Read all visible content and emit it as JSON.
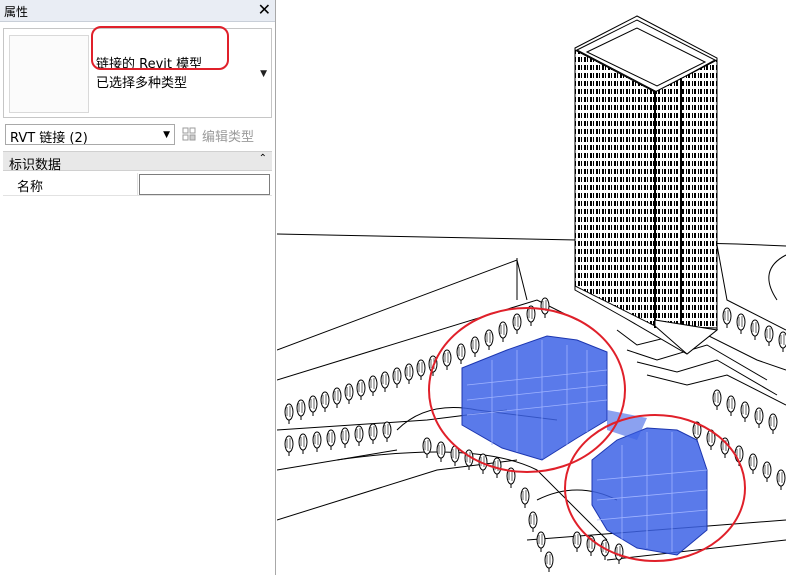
{
  "properties_panel": {
    "title": "属性",
    "close_glyph": "✕",
    "type_selector": {
      "line1": "链接的 Revit 模型",
      "line2": "已选择多种类型",
      "arrow": "▼"
    },
    "filter": {
      "value": "RVT 链接 (2)",
      "arrow": "▼"
    },
    "edit_type_label": "编辑类型",
    "group": {
      "label": "标识数据",
      "collapse_glyph": "⌃"
    },
    "rows": [
      {
        "label": "名称",
        "value": ""
      }
    ]
  },
  "icons": {
    "edit_type": "edit-type-icon",
    "close": "close-icon"
  },
  "colors": {
    "highlight_ellipse": "#e0202a",
    "selected_model": "#3d63e6",
    "panel_title_bg": "#e9edf4"
  }
}
